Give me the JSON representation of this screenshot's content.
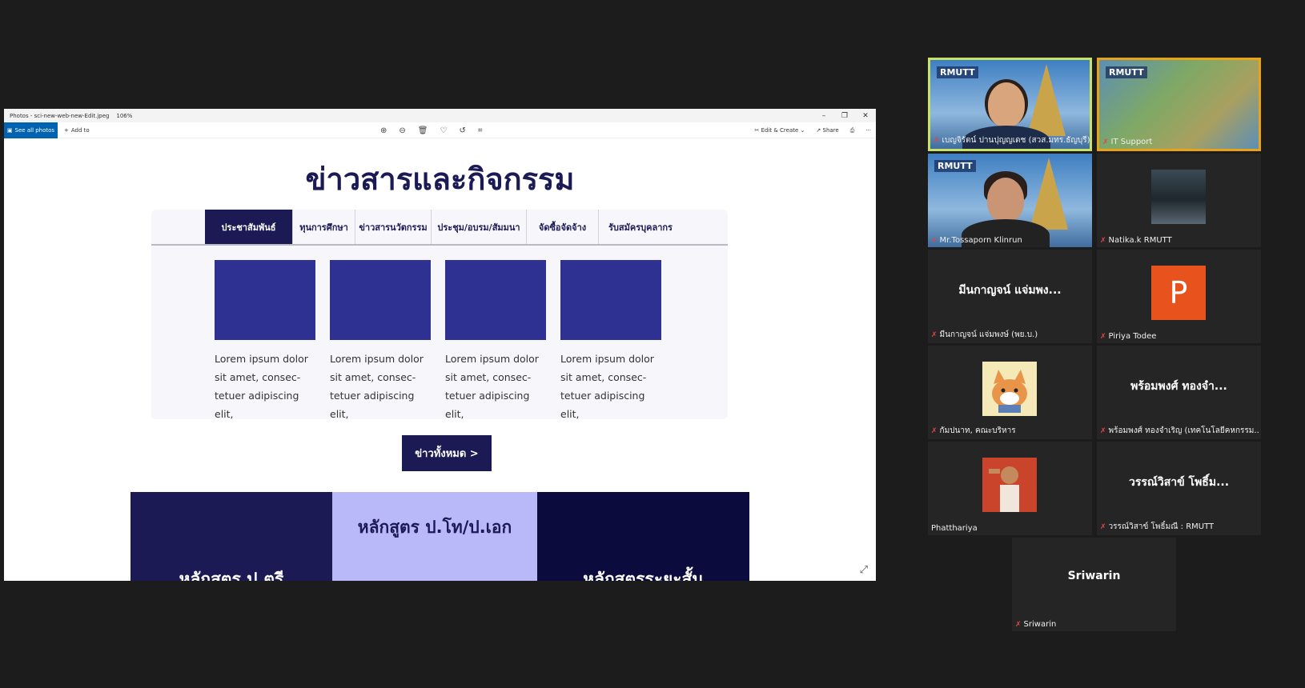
{
  "photos_window": {
    "title": "Photos - sci-new-web-new-Edit.jpeg",
    "zoom": "106%",
    "see_all_label": "See all photos",
    "add_to_label": "Add to",
    "edit_create_label": "Edit & Create",
    "share_label": "Share"
  },
  "webpage": {
    "heading": "ข่าวสารและกิจกรรม",
    "tabs": [
      {
        "label": "ประชาสัมพันธ์",
        "active": true
      },
      {
        "label": "ทุนการศึกษา",
        "active": false
      },
      {
        "label": "ข่าวสารนวัตกรรม",
        "active": false
      },
      {
        "label": "ประชุม/อบรม/สัมมนา",
        "active": false
      },
      {
        "label": "จัดซื้อจัดจ้าง",
        "active": false
      },
      {
        "label": "รับสมัครบุคลากร",
        "active": false
      }
    ],
    "cards": [
      {
        "text": "Lorem ipsum dolor sit amet, consec- tetuer adipiscing elit,"
      },
      {
        "text": "Lorem ipsum dolor sit amet, consec- tetuer adipiscing elit,"
      },
      {
        "text": "Lorem ipsum dolor sit amet, consec- tetuer adipiscing elit,"
      },
      {
        "text": "Lorem ipsum dolor sit amet, consec- tetuer adipiscing elit,"
      }
    ],
    "all_news_button": "ข่าวทั้งหมด >",
    "courses": [
      "หลักสูตร ป.ตรี",
      "หลักสูตร ป.โท/ป.เอก",
      "หลักสูตรระยะสั้น"
    ]
  },
  "participants": [
    {
      "name": "เบญจิรัตน์ ปานปุญญเดช (สวส.มทร.ธัญบุรี)",
      "muted": true,
      "type": "video-woman"
    },
    {
      "name": "IT Support",
      "muted": true,
      "type": "video-campus"
    },
    {
      "name": "Mr.Tossaporn Klinrun",
      "muted": true,
      "type": "video-man"
    },
    {
      "name": "Natika.k RMUTT",
      "muted": true,
      "type": "photo"
    },
    {
      "name": "มีนกาญจน์ แจ่มพงษ์ (พย.บ.)",
      "display": "มีนกาญจน์ แจ่มพง...",
      "muted": true,
      "type": "name"
    },
    {
      "name": "Piriya Todee",
      "initial": "P",
      "muted": true,
      "type": "initial"
    },
    {
      "name": "กัมปนาท, คณะบริหาร",
      "muted": true,
      "type": "cat"
    },
    {
      "name": "พร้อมพงศ์ ทองจำเริญ (เทคโนโลยีคหกรรม...",
      "display": "พร้อมพงศ์ ทองจำ...",
      "muted": true,
      "type": "name"
    },
    {
      "name": "Phatthariya",
      "muted": false,
      "type": "man-photo"
    },
    {
      "name": "วรรณ์วิสาข์ โพธิ์มณี : RMUTT",
      "display": "วรรณ์วิสาข์ โพธิ์ม...",
      "muted": true,
      "type": "name"
    },
    {
      "name": "Sriwarin",
      "display": "Sriwarin",
      "muted": true,
      "type": "name"
    }
  ],
  "colors": {
    "brand_navy": "#1b1a55",
    "card_blue": "#2e3192",
    "course_lavender": "#b9b8f8",
    "speaking_border": "#c7e265"
  }
}
